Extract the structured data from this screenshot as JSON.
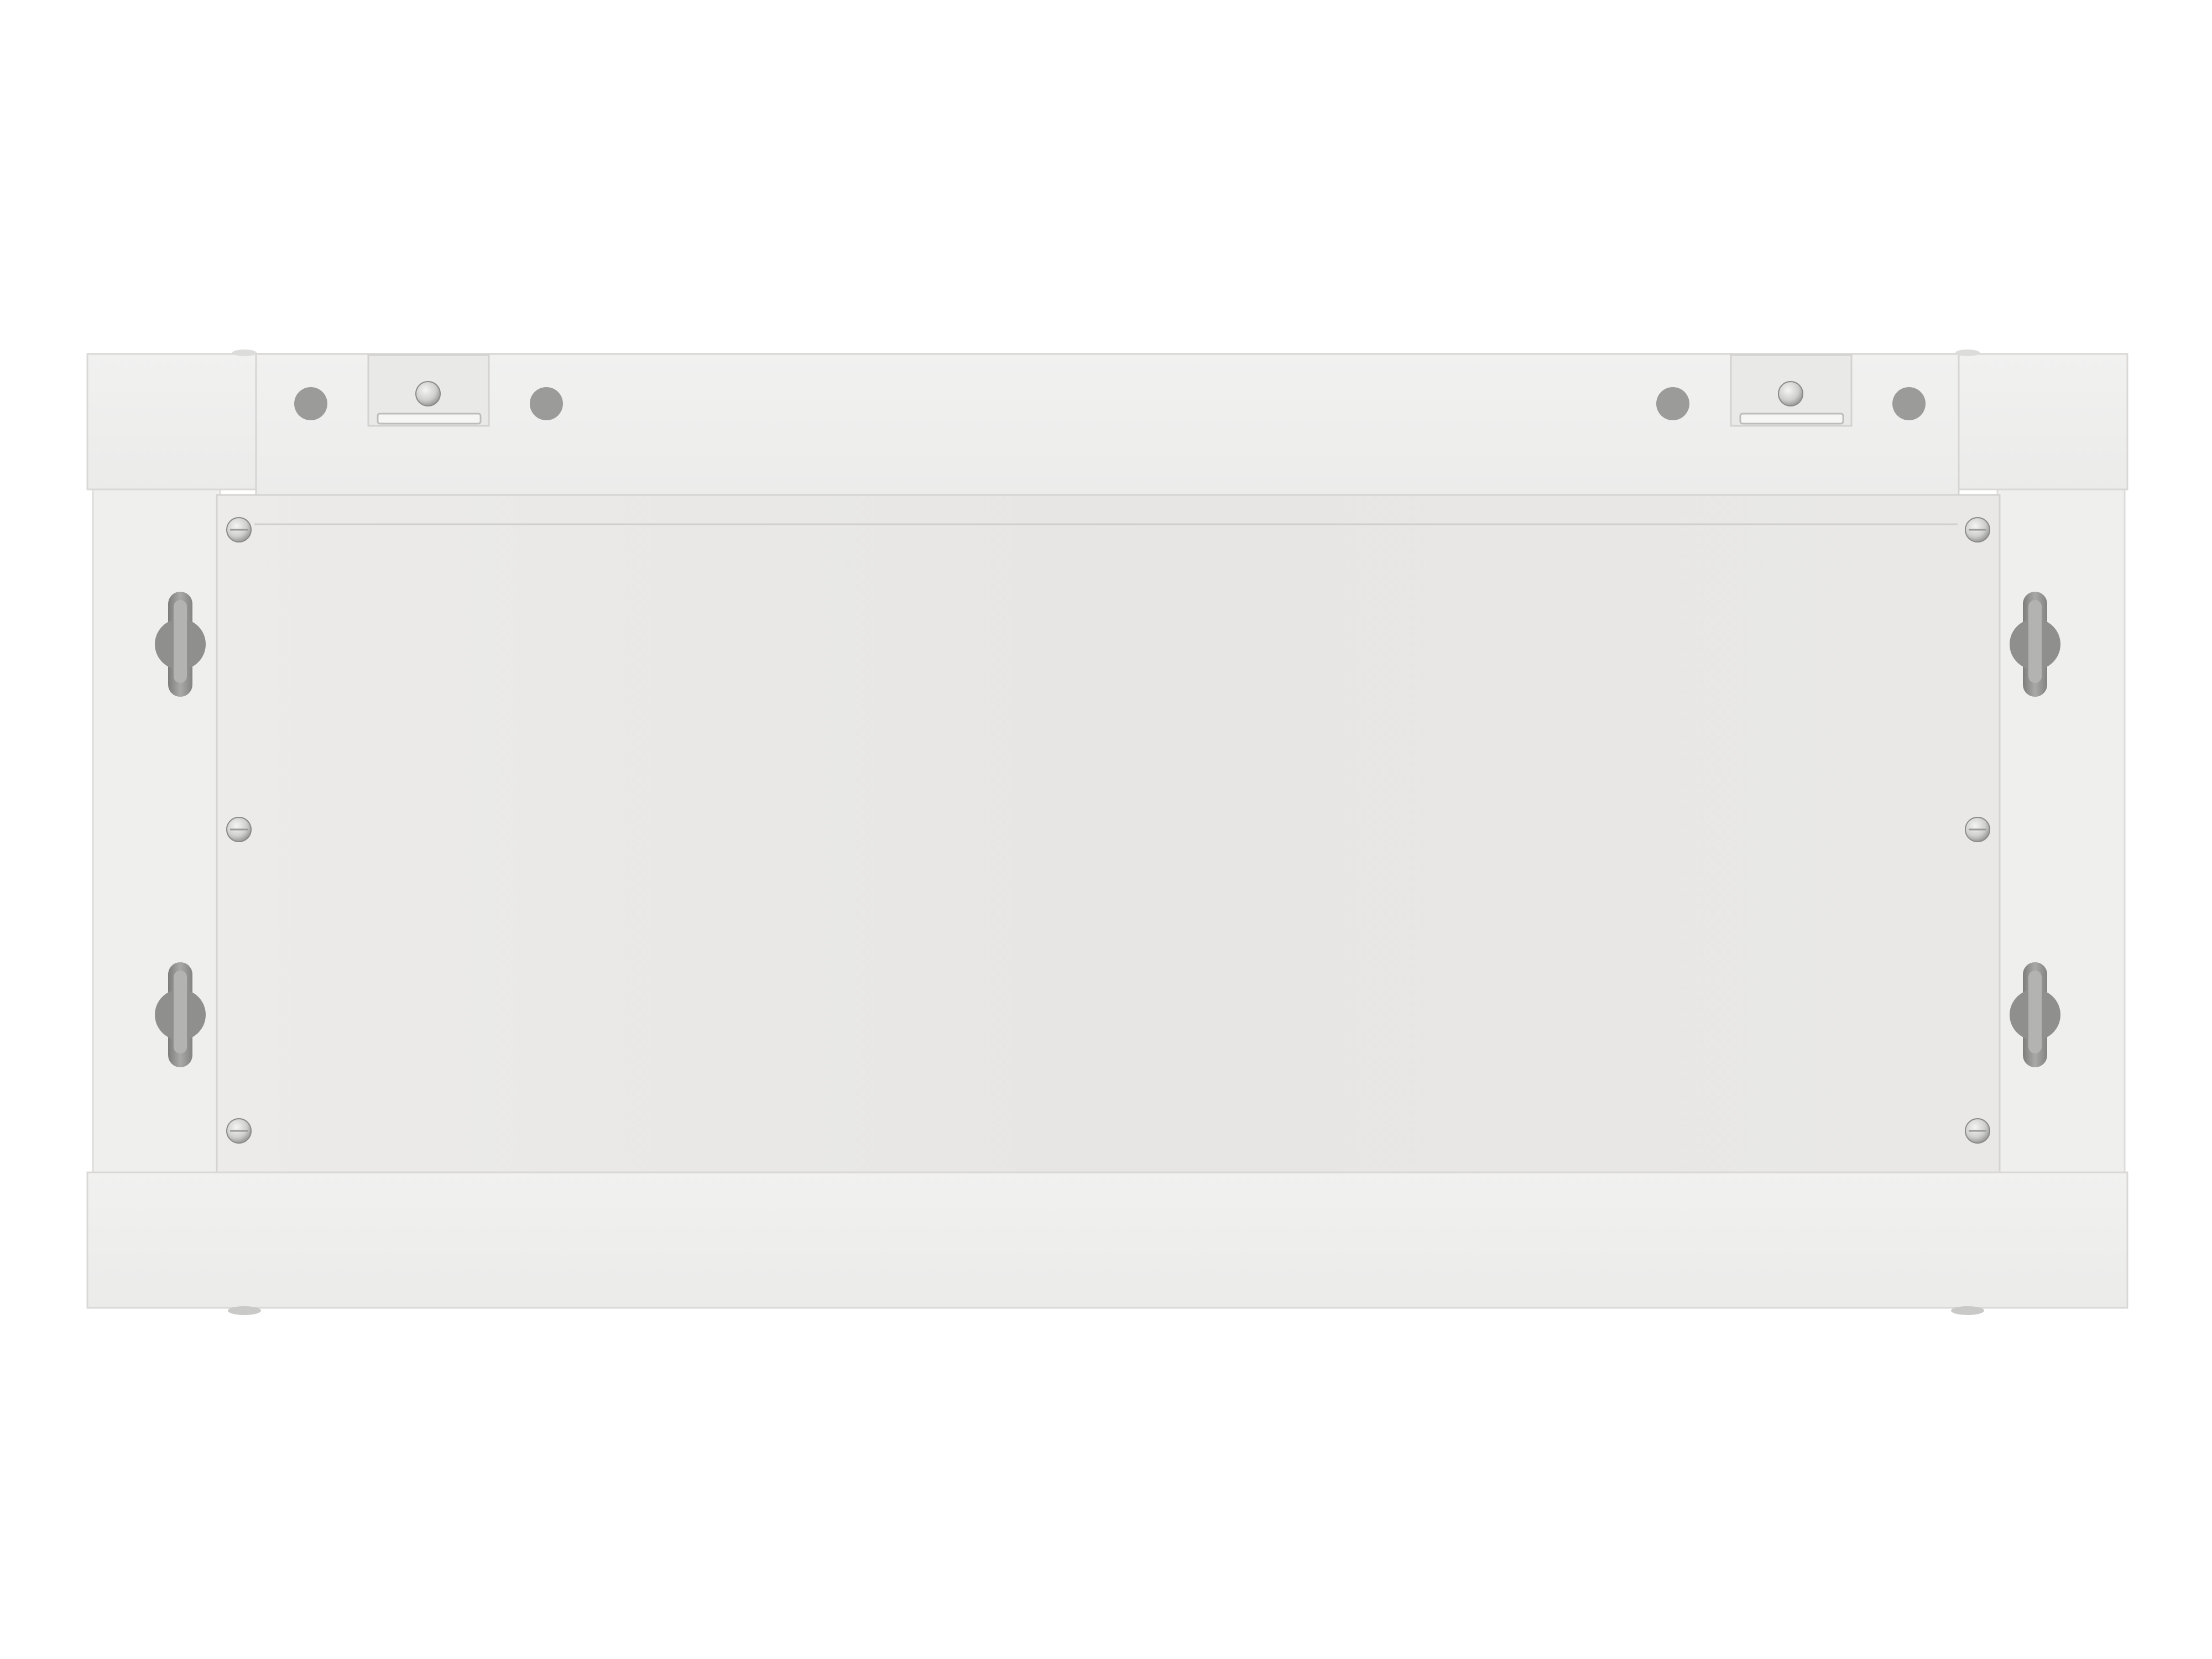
{
  "image": {
    "subject": "rack-cabinet-rear-panel",
    "colors": {
      "background": "#ffffff",
      "panel": "#e8e7e5",
      "frame": "#eeeeec",
      "edge": "#d6d5d2",
      "hole": "#9b9b99",
      "slot": "#8f8f8d",
      "screw": "#c6c6c4"
    }
  }
}
